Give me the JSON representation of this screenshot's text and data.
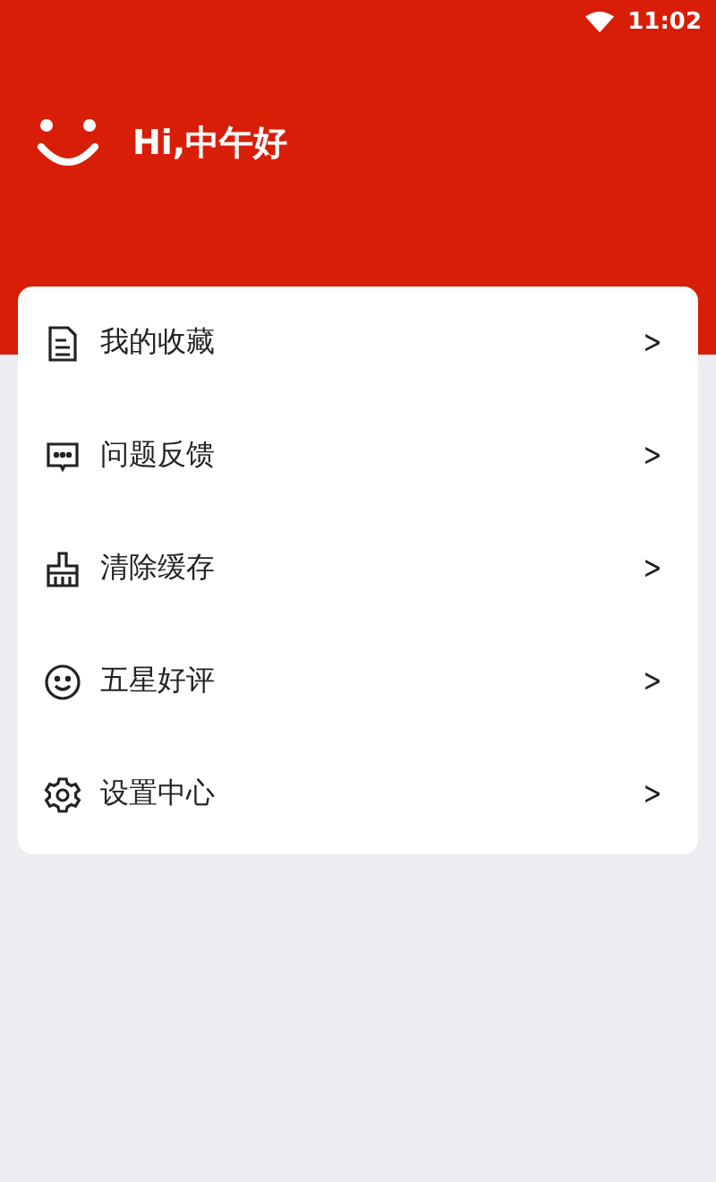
{
  "status_bar": {
    "time": "11:02"
  },
  "header": {
    "greeting": "Hi,中午好"
  },
  "menu": [
    {
      "kind": "document",
      "label": "我的收藏",
      "chevron": ">"
    },
    {
      "kind": "chat",
      "label": "问题反馈",
      "chevron": ">"
    },
    {
      "kind": "broom",
      "label": "清除缓存",
      "chevron": ">"
    },
    {
      "kind": "smile",
      "label": "五星好评",
      "chevron": ">"
    },
    {
      "kind": "gear",
      "label": "设置中心",
      "chevron": ">"
    }
  ]
}
